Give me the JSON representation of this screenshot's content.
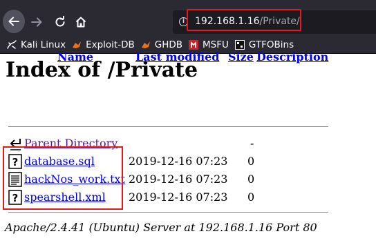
{
  "browser": {
    "url_host": "192.168.1.16",
    "url_path": "/Private/"
  },
  "bookmarks": [
    {
      "label": "Kali Linux",
      "icon": "kali-dragon-icon"
    },
    {
      "label": "Exploit-DB",
      "icon": "exploitdb-icon"
    },
    {
      "label": "GHDB",
      "icon": "ghdb-icon"
    },
    {
      "label": "MSFU",
      "icon": "msfu-icon"
    },
    {
      "label": "GTFOBins",
      "icon": "gtfobins-icon"
    }
  ],
  "page": {
    "title": "Index of /Private",
    "columns": {
      "name": "Name",
      "last_modified": "Last modified",
      "size": "Size",
      "description": "Description"
    },
    "parent": {
      "label": "Parent Directory",
      "size": "-"
    },
    "rows": [
      {
        "name": "database.sql",
        "modified": "2019-12-16 07:23",
        "size": "0"
      },
      {
        "name": "hackNos_work.txt",
        "modified": "2019-12-16 07:23",
        "size": "0"
      },
      {
        "name": "spearshell.xml",
        "modified": "2019-12-16 07:23",
        "size": "0"
      }
    ],
    "footer": "Apache/2.4.41 (Ubuntu) Server at 192.168.1.16 Port 80"
  },
  "colors": {
    "link": "#0000ee",
    "visited": "#551a8b",
    "highlight": "#e31b1b",
    "toolbar": "#2b2a33"
  }
}
